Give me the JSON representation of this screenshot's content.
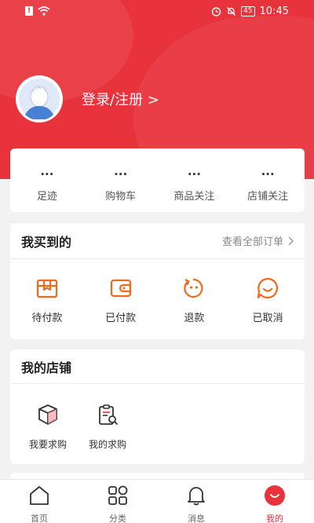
{
  "status_bar": {
    "time": "10:45",
    "battery": "45"
  },
  "profile": {
    "login_label": "登录/注册 >"
  },
  "stats": [
    {
      "value": "...",
      "label": "足迹"
    },
    {
      "value": "...",
      "label": "购物车"
    },
    {
      "value": "...",
      "label": "商品关注"
    },
    {
      "value": "...",
      "label": "店铺关注"
    }
  ],
  "orders": {
    "title": "我买到的",
    "view_all": "查看全部订单",
    "items": [
      {
        "label": "待付款",
        "icon": "box-icon"
      },
      {
        "label": "已付款",
        "icon": "wallet-icon"
      },
      {
        "label": "退款",
        "icon": "refund-icon"
      },
      {
        "label": "已取消",
        "icon": "chat-smile-icon"
      }
    ]
  },
  "shop": {
    "title": "我的店铺",
    "items": [
      {
        "label": "我要求购",
        "icon": "package-icon"
      },
      {
        "label": "我的求购",
        "icon": "clipboard-search-icon"
      }
    ]
  },
  "tabbar": {
    "items": [
      {
        "label": "首页",
        "icon": "home-icon"
      },
      {
        "label": "分类",
        "icon": "category-icon"
      },
      {
        "label": "消息",
        "icon": "bell-icon"
      },
      {
        "label": "我的",
        "icon": "profile-smile-icon",
        "active": true
      }
    ]
  },
  "colors": {
    "brand_red": "#e8323c",
    "accent_orange": "#f06a1b",
    "background": "#f2f2f2"
  }
}
